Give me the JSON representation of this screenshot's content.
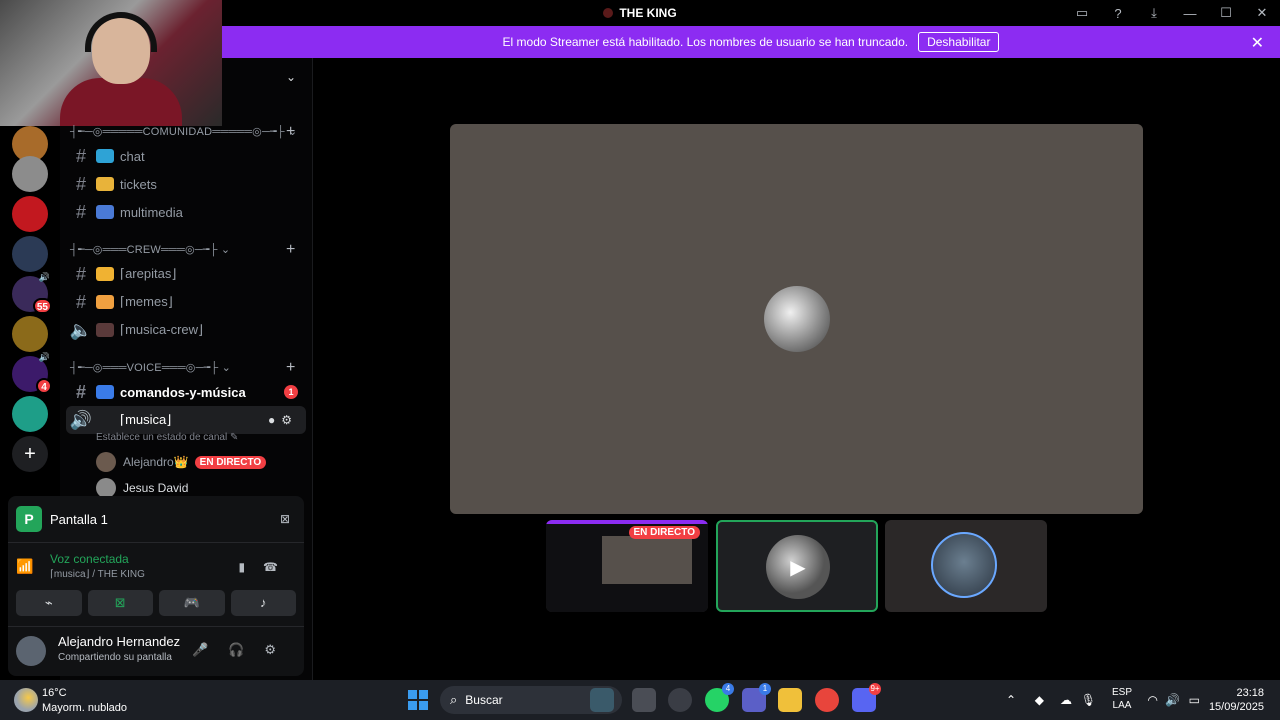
{
  "window": {
    "title": "THE KING"
  },
  "banner": {
    "message": "El modo Streamer está habilitado. Los nombres de usuario se han truncado.",
    "button_label": "Deshabilitar"
  },
  "guilds": [
    {
      "color": "#a86b2a"
    },
    {
      "color": "#8c8c8c"
    },
    {
      "color": "#c2181f"
    },
    {
      "color": "#2b3a55"
    },
    {
      "color": "#3a2a5a",
      "badge": "55",
      "voice": true
    },
    {
      "color": "#8b6a1a"
    },
    {
      "color": "#3c1a6a",
      "badge": "4",
      "voice": true
    },
    {
      "color": "#1e9e88"
    }
  ],
  "categories": [
    {
      "label": "┤╾─◎═════COMUNIDAD═════◎─╼├"
    },
    {
      "label": "┤╾─◎═══CREW═══◎─╼├"
    },
    {
      "label": "┤╾─◎═══VOICE═══◎─╼├"
    }
  ],
  "channels": [
    {
      "label": "chat",
      "emoji_color": "#2ea3d6"
    },
    {
      "label": "tickets",
      "emoji_color": "#e8b33a"
    },
    {
      "label": "multimedia",
      "emoji_color": "#4a7ad6"
    },
    {
      "label": "⌈arepitas⌋",
      "emoji_color": "#f0b232"
    },
    {
      "label": "⌈memes⌋",
      "emoji_color": "#f0a040"
    },
    {
      "label": "⌈musica-crew⌋",
      "emoji_color": "#5a3a3a"
    },
    {
      "label": "comandos-y-música",
      "emoji_color": "#3a7be8",
      "mention": "1"
    },
    {
      "label": "⌈musica⌋"
    }
  ],
  "voice_channel_status": "Establece un estado de canal",
  "voice_users": [
    {
      "name": "Alejandro",
      "live_label": "EN DIRECTO"
    },
    {
      "name": "Jesus David"
    }
  ],
  "screen_share": {
    "label": "Pantalla 1",
    "icon_letter": "P"
  },
  "voice_connection": {
    "status": "Voz conectada",
    "location": "⌈musica⌋ / THE KING"
  },
  "user": {
    "name": "Alejandro Hernandez",
    "status": "Compartiendo su pantalla"
  },
  "stage": {
    "live_label": "EN DIRECTO"
  },
  "taskbar": {
    "temperature": "16°C",
    "weather": "Mayorm. nublado",
    "search_label": "Buscar",
    "lang_top": "ESP",
    "lang_bottom": "LAA",
    "time": "23:18",
    "date": "15/09/2025",
    "meet_badge": "1",
    "whatsapp_badge": "4",
    "discord_badge": "9+"
  },
  "colors": {
    "accent_purple": "#8c2cf2",
    "live_red": "#f23f43",
    "connected_green": "#23a55a"
  }
}
